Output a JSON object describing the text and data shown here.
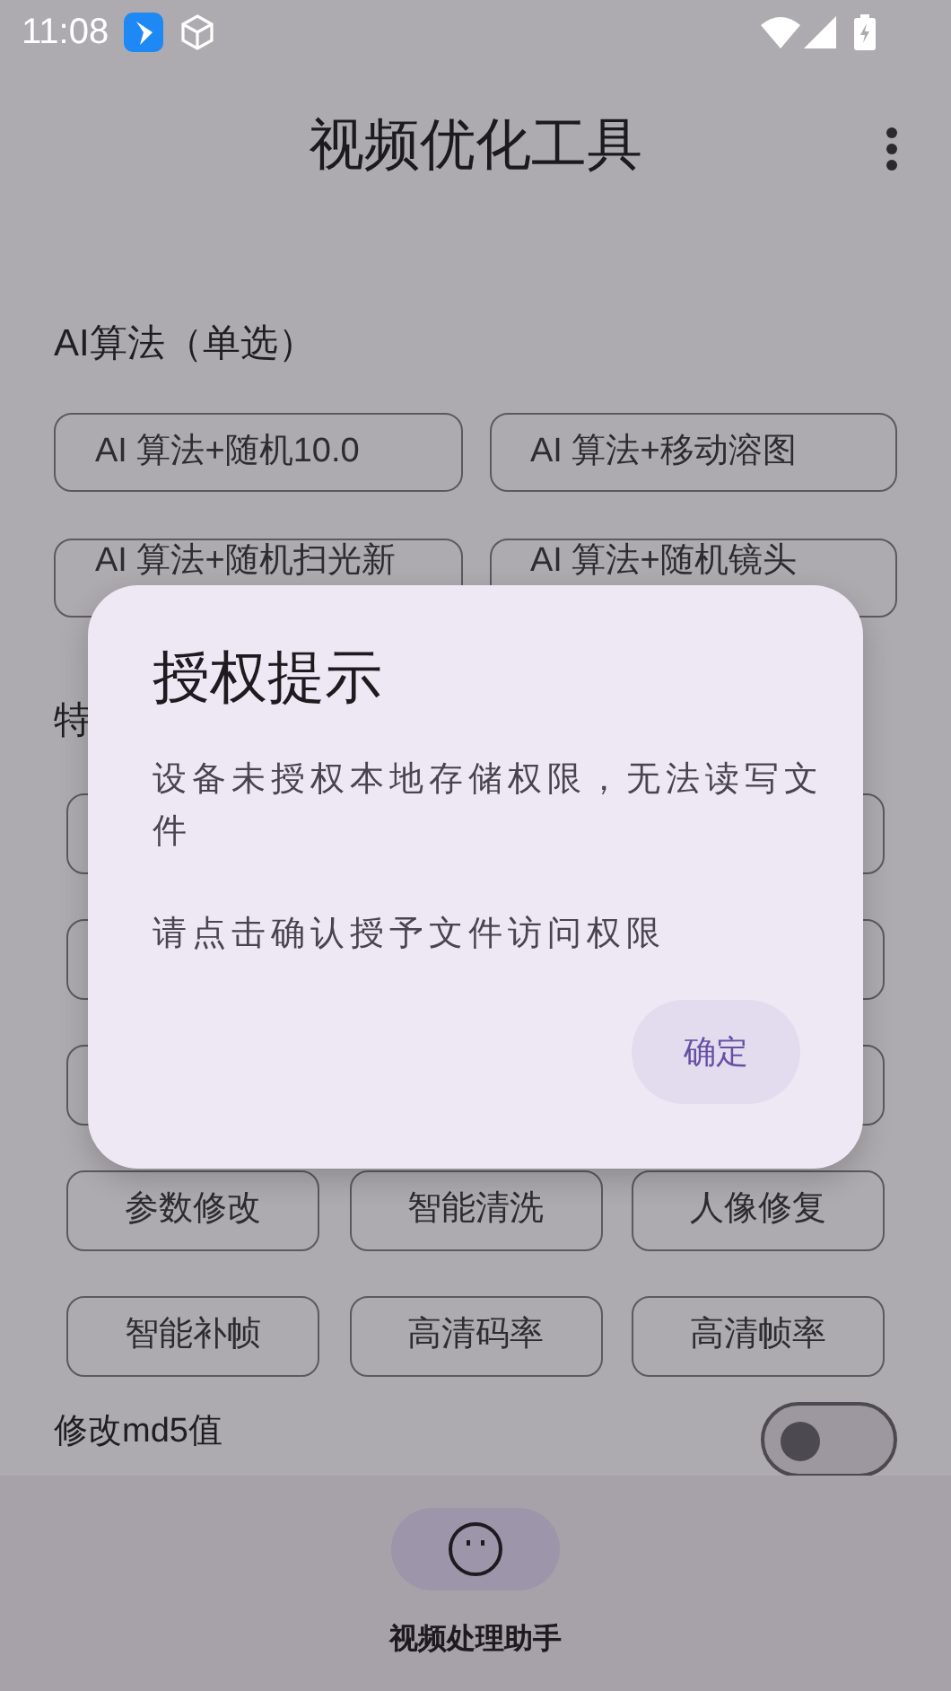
{
  "status_bar": {
    "time": "11:08"
  },
  "app_bar": {
    "title": "视频优化工具"
  },
  "ai_section": {
    "title": "AI算法（单选）",
    "options": [
      {
        "label": "AI 算法+随机10.0"
      },
      {
        "label": "AI 算法+移动溶图"
      },
      {
        "label": "AI 算法+随机扫光新"
      },
      {
        "label": "AI 算法+随机镜头"
      }
    ]
  },
  "feature_section": {
    "title": "特",
    "rows": [
      {
        "chips": [
          {
            "kind": "covered"
          },
          {
            "kind": "covered"
          }
        ]
      },
      {
        "chips": [
          {
            "kind": "covered"
          },
          {
            "kind": "covered"
          }
        ]
      },
      {
        "chips": [
          {
            "kind": "covered"
          },
          {
            "kind": "covered"
          }
        ]
      },
      {
        "chips": [
          {
            "kind": "chip",
            "label": "参数修改"
          },
          {
            "kind": "chip",
            "label": "智能清洗"
          },
          {
            "kind": "chip",
            "label": "人像修复"
          }
        ]
      },
      {
        "chips": [
          {
            "kind": "chip",
            "label": "智能补帧"
          },
          {
            "kind": "chip",
            "label": "高清码率"
          },
          {
            "kind": "chip",
            "label": "高清帧率"
          }
        ]
      }
    ]
  },
  "md5_setting": {
    "label": "修改md5值",
    "on": false
  },
  "bottom_nav": {
    "items": [
      {
        "label": "视频处理助手",
        "selected": true
      }
    ]
  },
  "dialog": {
    "title": "授权提示",
    "paragraphs": [
      "设备未授权本地存储权限，无法读写文件",
      "请点击确认授予文件访问权限"
    ],
    "button": "确定"
  }
}
